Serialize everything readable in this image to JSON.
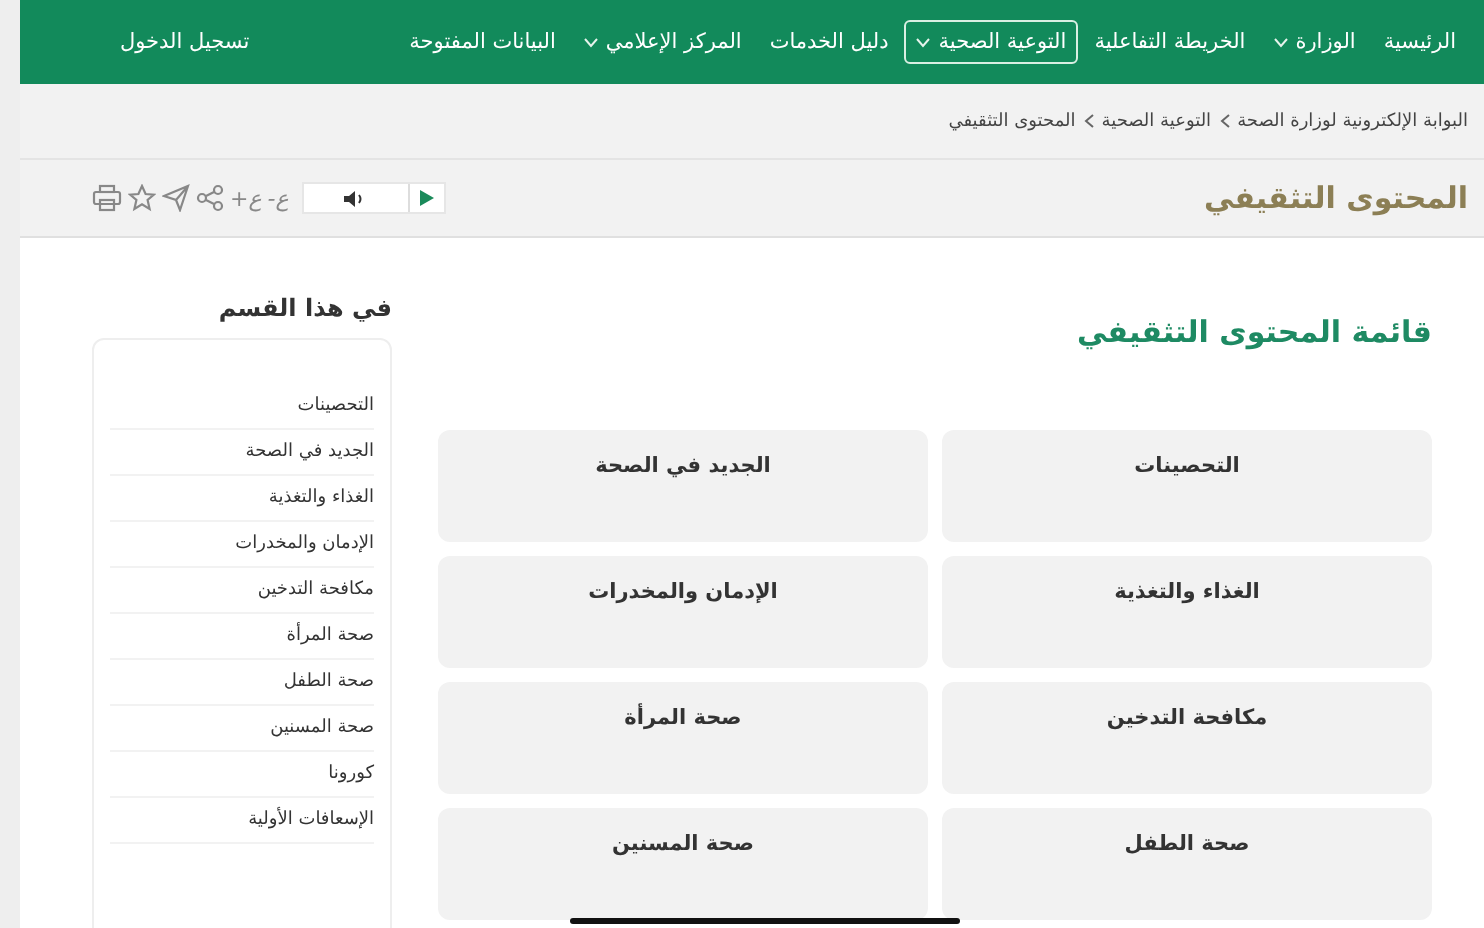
{
  "nav": {
    "items": [
      {
        "label": "الرئيسية",
        "dropdown": false,
        "selected": false
      },
      {
        "label": "الوزارة",
        "dropdown": true,
        "selected": false
      },
      {
        "label": "الخريطة التفاعلية",
        "dropdown": false,
        "selected": false
      },
      {
        "label": "التوعية الصحية",
        "dropdown": true,
        "selected": true
      },
      {
        "label": "دليل الخدمات",
        "dropdown": false,
        "selected": false
      },
      {
        "label": "المركز الإعلامي",
        "dropdown": true,
        "selected": false
      },
      {
        "label": "البيانات المفتوحة",
        "dropdown": false,
        "selected": false
      }
    ],
    "login": "تسجيل الدخول"
  },
  "breadcrumb": [
    "البوابة الإلكترونية لوزارة الصحة",
    "التوعية الصحية",
    "المحتوى التثقيفي"
  ],
  "page_title": "المحتوى التثقيفي",
  "toolbar": {
    "font_increase": "ع+",
    "font_decrease": "ع-"
  },
  "sidebar": {
    "heading": "في هذا **القسم**",
    "items": [
      "التحصينات",
      "الجديد في الصحة",
      "الغذاء والتغذية",
      "الإدمان والمخدرات",
      "مكافحة التدخين",
      "صحة المرأة",
      "صحة الطفل",
      "صحة المسنين",
      "كورونا",
      "الإسعافات الأولية"
    ]
  },
  "main": {
    "heading": "قائمة المحتوى التثقيفي",
    "cards": [
      "التحصينات",
      "الجديد في الصحة",
      "الغذاء والتغذية",
      "الإدمان والمخدرات",
      "مكافحة التدخين",
      "صحة المرأة",
      "صحة الطفل",
      "صحة المسنين"
    ]
  }
}
